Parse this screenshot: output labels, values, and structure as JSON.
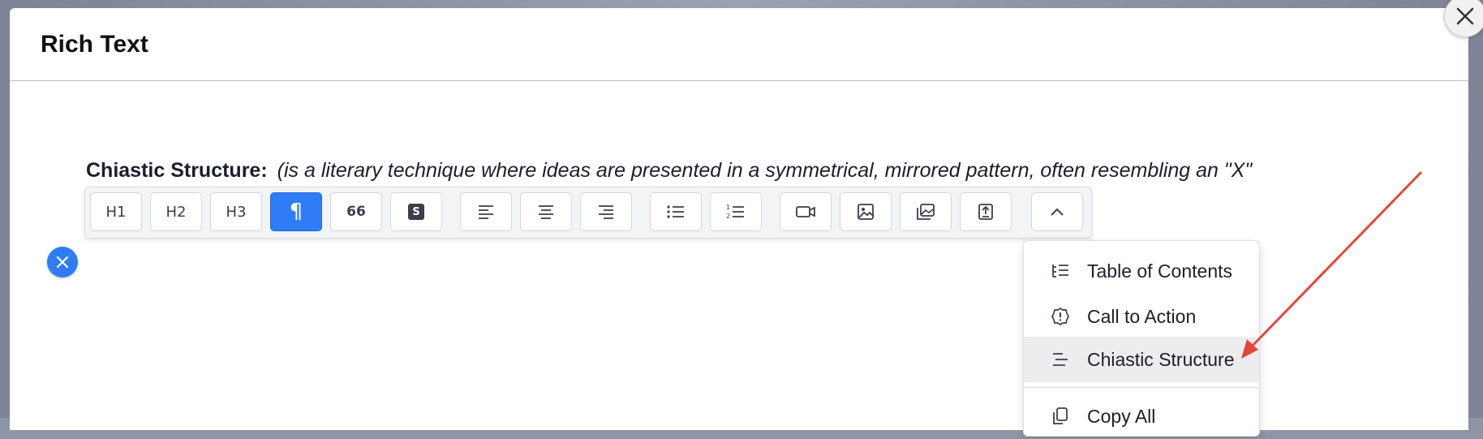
{
  "modal": {
    "title": "Rich Text",
    "close_icon": "close-icon"
  },
  "editor": {
    "label": "Chiastic Structure:",
    "description": "(is a literary technique where ideas are presented in a symmetrical, mirrored pattern, often resembling an \"X\""
  },
  "toolbar": {
    "buttons": [
      {
        "label": "H1",
        "icon": "heading-1-icon"
      },
      {
        "label": "H2",
        "icon": "heading-2-icon"
      },
      {
        "label": "H3",
        "icon": "heading-3-icon"
      },
      {
        "label": "¶",
        "icon": "paragraph-icon",
        "active": true
      },
      {
        "label": "66",
        "icon": "quote-icon"
      },
      {
        "label": "S",
        "icon": "strikethrough-icon"
      },
      {
        "icon": "align-left-icon"
      },
      {
        "icon": "align-center-icon"
      },
      {
        "icon": "align-right-icon"
      },
      {
        "icon": "bullet-list-icon"
      },
      {
        "icon": "numbered-list-icon"
      },
      {
        "icon": "video-icon"
      },
      {
        "icon": "image-icon"
      },
      {
        "icon": "gallery-icon"
      },
      {
        "icon": "upload-icon"
      },
      {
        "icon": "chevron-up-icon"
      }
    ]
  },
  "remove_button": {
    "icon": "close-icon"
  },
  "dropdown": {
    "items": [
      {
        "label": "Table of Contents",
        "icon": "table-of-contents-icon"
      },
      {
        "label": "Call to Action",
        "icon": "call-to-action-icon"
      },
      {
        "label": "Chiastic Structure",
        "icon": "chiastic-structure-icon",
        "highlighted": true
      },
      {
        "label": "Copy All",
        "icon": "copy-icon"
      }
    ]
  },
  "colors": {
    "accent": "#2f7cf6",
    "annotation_arrow": "#e2473b"
  }
}
